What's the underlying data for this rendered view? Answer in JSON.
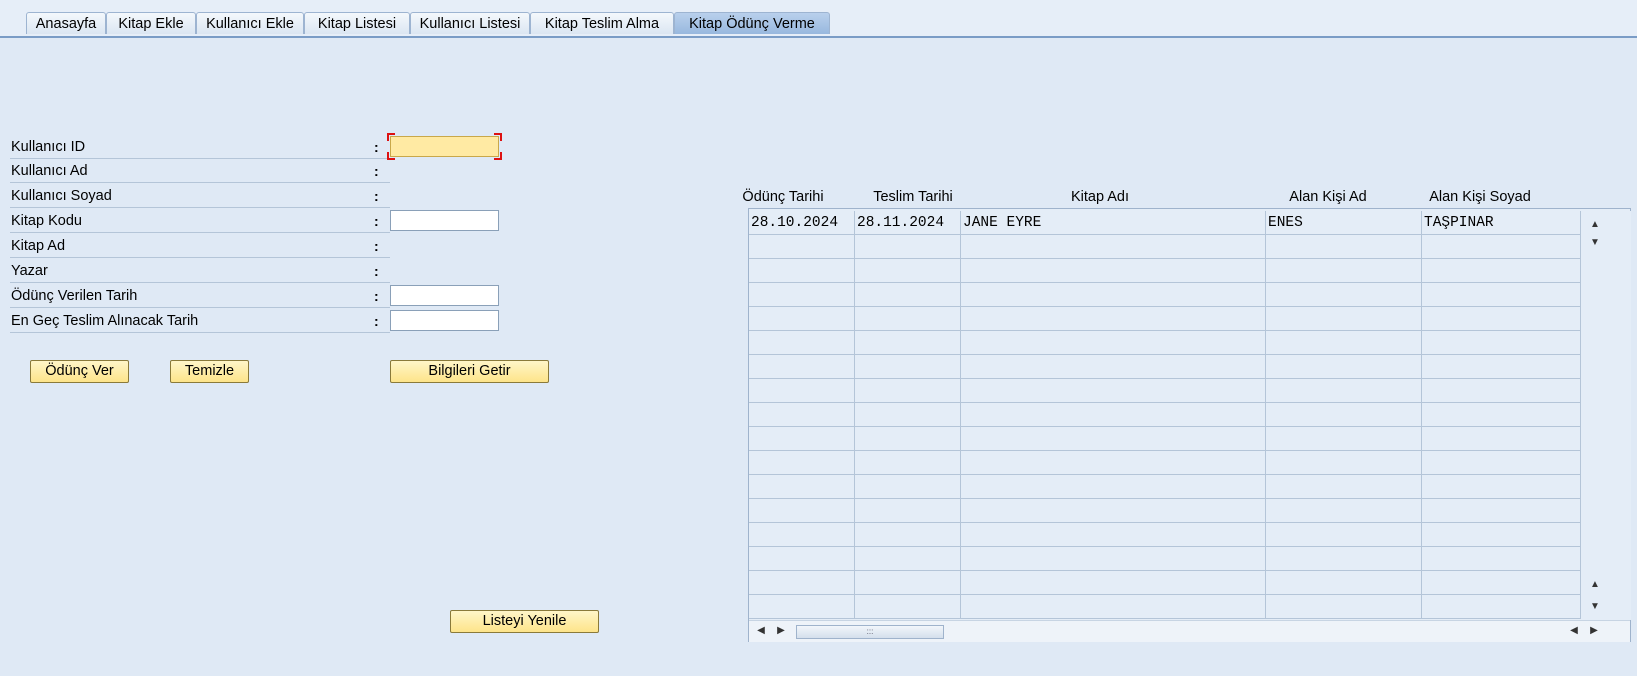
{
  "tabs": [
    {
      "label": "Anasayfa",
      "active": false
    },
    {
      "label": "Kitap Ekle",
      "active": false
    },
    {
      "label": "Kullanıcı Ekle",
      "active": false
    },
    {
      "label": "Kitap Listesi",
      "active": false
    },
    {
      "label": "Kullanıcı Listesi",
      "active": false
    },
    {
      "label": "Kitap Teslim Alma",
      "active": false
    },
    {
      "label": "Kitap Ödünç Verme",
      "active": true
    }
  ],
  "form": {
    "colon": ":",
    "fields": [
      {
        "label": "Kullanıcı ID",
        "value": "",
        "has_input": true,
        "focused": true
      },
      {
        "label": "Kullanıcı Ad",
        "value": "",
        "has_input": false
      },
      {
        "label": "Kullanıcı Soyad",
        "value": "",
        "has_input": false
      },
      {
        "label": "Kitap Kodu",
        "value": "",
        "has_input": true
      },
      {
        "label": "Kitap Ad",
        "value": "",
        "has_input": false
      },
      {
        "label": "Yazar",
        "value": "",
        "has_input": false
      },
      {
        "label": "Ödünç Verilen Tarih",
        "value": "",
        "has_input": true
      },
      {
        "label": "En Geç Teslim Alınacak Tarih",
        "value": "",
        "has_input": true
      }
    ]
  },
  "buttons": {
    "lend": "Ödünç Ver",
    "clear": "Temizle",
    "fetch": "Bilgileri Getir",
    "refresh": "Listeyi Yenile"
  },
  "grid": {
    "columns": [
      "Ödünç Tarihi",
      "Teslim Tarihi",
      "Kitap Adı",
      "Alan Kişi Ad",
      "Alan Kişi Soyad"
    ],
    "rows": [
      [
        "28.10.2024",
        "28.11.2024",
        "JANE EYRE",
        "ENES",
        "TAŞPINAR"
      ]
    ],
    "thumb_grip": ":::"
  },
  "colors": {
    "background": "#dfe9f5",
    "button": "#fde48a",
    "active_tab": "#98b8de",
    "focused_input": "#ffeaa3"
  }
}
